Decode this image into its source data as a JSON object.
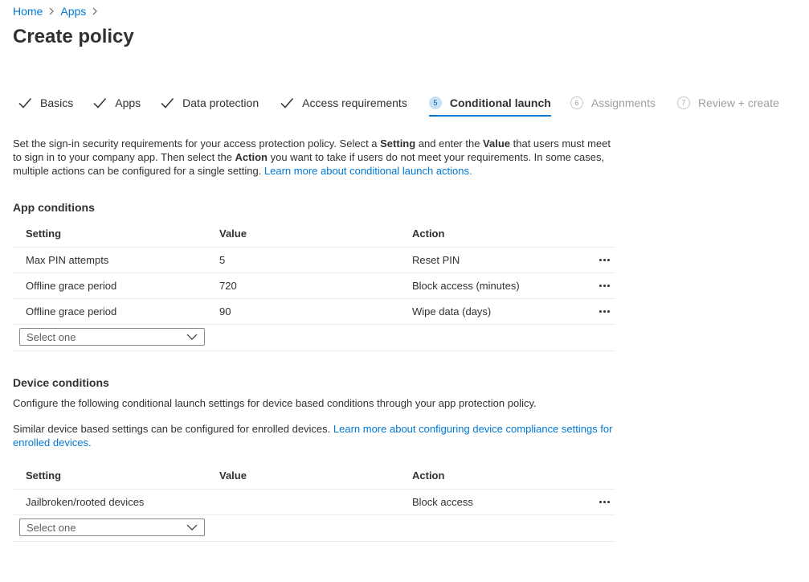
{
  "breadcrumb": {
    "home": "Home",
    "apps": "Apps"
  },
  "page_title": "Create policy",
  "steps": [
    {
      "label": "Basics",
      "state": "done"
    },
    {
      "label": "Apps",
      "state": "done"
    },
    {
      "label": "Data protection",
      "state": "done"
    },
    {
      "label": "Access requirements",
      "state": "done"
    },
    {
      "number": "5",
      "label": "Conditional launch",
      "state": "active"
    },
    {
      "number": "6",
      "label": "Assignments",
      "state": "todo"
    },
    {
      "number": "7",
      "label": "Review + create",
      "state": "todo"
    }
  ],
  "description": {
    "part1": "Set the sign-in security requirements for your access protection policy. Select a ",
    "bold1": "Setting",
    "part2": " and enter the ",
    "bold2": "Value",
    "part3": " that users must meet to sign in to your company app. Then select the ",
    "bold3": "Action",
    "part4": " you want to take if users do not meet your requirements. In some cases, multiple actions can be configured for a single setting. ",
    "link": "Learn more about conditional launch actions."
  },
  "app_conditions": {
    "title": "App conditions",
    "headers": {
      "setting": "Setting",
      "value": "Value",
      "action": "Action"
    },
    "rows": [
      {
        "setting": "Max PIN attempts",
        "value": "5",
        "action": "Reset PIN"
      },
      {
        "setting": "Offline grace period",
        "value": "720",
        "action": "Block access (minutes)"
      },
      {
        "setting": "Offline grace period",
        "value": "90",
        "action": "Wipe data (days)"
      }
    ],
    "select_placeholder": "Select one"
  },
  "device_conditions": {
    "title": "Device conditions",
    "text1": "Configure the following conditional launch settings for device based conditions through your app protection policy.",
    "text2": "Similar device based settings can be configured for enrolled devices. ",
    "link": "Learn more about configuring device compliance settings for enrolled devices.",
    "headers": {
      "setting": "Setting",
      "value": "Value",
      "action": "Action"
    },
    "rows": [
      {
        "setting": "Jailbroken/rooted devices",
        "value": "",
        "action": "Block access"
      }
    ],
    "select_placeholder": "Select one"
  },
  "colors": {
    "accent": "#0078d4",
    "text": "#323130",
    "muted": "#a19f9d",
    "border": "#edebe9"
  },
  "icons": {
    "step_done": "checkmark-icon",
    "more": "more-dots-icon",
    "dropdown": "chevron-down-icon",
    "breadcrumb_sep": "chevron-right-icon"
  }
}
